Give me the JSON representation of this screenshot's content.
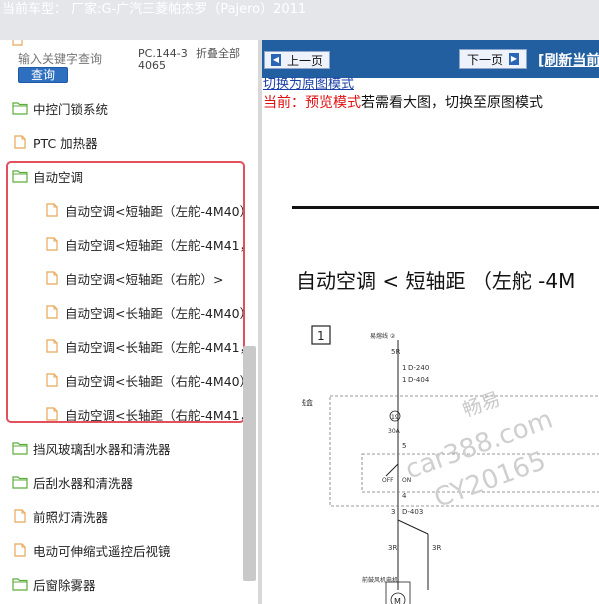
{
  "header": {
    "vehicle": "当前车型： 厂家:G-广汽三菱帕杰罗（Pajero）2011"
  },
  "left": {
    "search_placeholder": "输入关键字查询",
    "query_label": "查询",
    "pc_number": "PC.144-34065",
    "collapse_label": "折叠全部",
    "items": [
      {
        "label": "中控门锁系统",
        "type": "folder"
      },
      {
        "label": "PTC 加热器",
        "type": "file"
      },
      {
        "label": "自动空调",
        "type": "folder"
      },
      {
        "label": "自动空调<短轴距（左舵-4M40）",
        "type": "file"
      },
      {
        "label": "自动空调<短轴距（左舵-4M41，",
        "type": "file"
      },
      {
        "label": "自动空调<短轴距（右舵）>",
        "type": "file"
      },
      {
        "label": "自动空调<长轴距（左舵-4M40）",
        "type": "file"
      },
      {
        "label": "自动空调<长轴距（左舵-4M41，",
        "type": "file"
      },
      {
        "label": "自动空调<长轴距（右舵-4M40）",
        "type": "file"
      },
      {
        "label": "自动空调<长轴距（右舵-4M41，",
        "type": "file"
      },
      {
        "label": "挡风玻璃刮水器和清洗器",
        "type": "folder"
      },
      {
        "label": "后刮水器和清洗器",
        "type": "folder"
      },
      {
        "label": "前照灯清洗器",
        "type": "file"
      },
      {
        "label": "电动可伸缩式遥控后视镜",
        "type": "file"
      },
      {
        "label": "后窗除雾器",
        "type": "folder"
      }
    ]
  },
  "right": {
    "prev_label": "上一页",
    "next_label": "下一页",
    "refresh_label": "[刷新当前",
    "switch_link": "切换为原图模式",
    "current_prefix": "当前：预览模式",
    "current_suffix": "若需看大图，切换至原图模式",
    "doc_title_cn": "自动空调 < 短轴距 （左舵 -4M",
    "watermark": {
      "brand": "畅易",
      "site": "car388.com",
      "code": "CY20165"
    },
    "diagram": {
      "box_number": "1",
      "fuse_top_label": "易熔线 ②",
      "wire_5r": "5R",
      "conn_1a": "1",
      "code_240": "D-240",
      "conn_1b": "1",
      "code_404": "D-404",
      "side_label": "接线盒",
      "fuse_num": "19",
      "amp": "30A",
      "pin5": "5",
      "off": "OFF",
      "on": "ON",
      "pin4": "4",
      "pin3": "3",
      "code_403": "D-403",
      "wire_3r_a": "3R",
      "wire_3r_b": "3R",
      "motor_label": "前鼓风机电机",
      "motor_symbol": "M"
    }
  },
  "colors": {
    "nav_blue": "#225fa0",
    "highlight": "#e0505e",
    "folder_green": "#5cae3c",
    "file_orange": "#e8a65a"
  }
}
